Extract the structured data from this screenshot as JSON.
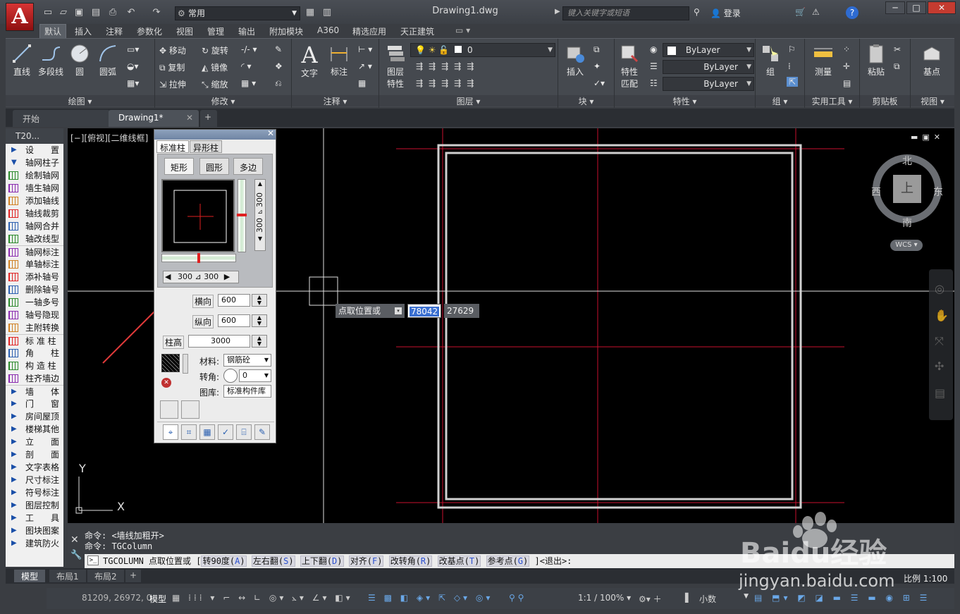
{
  "app": {
    "logo_letter": "A",
    "workspace": "常用",
    "document_title": "Drawing1.dwg",
    "search_placeholder": "键入关键字或短语",
    "login_label": "登录"
  },
  "menu": [
    "默认",
    "插入",
    "注释",
    "参数化",
    "视图",
    "管理",
    "输出",
    "附加模块",
    "A360",
    "精选应用",
    "天正建筑"
  ],
  "ribbon": {
    "draw": {
      "title": "绘图",
      "line": "直线",
      "polyline": "多段线",
      "circle": "圆",
      "arc": "圆弧"
    },
    "modify": {
      "title": "修改",
      "move": "移动",
      "rotate": "旋转",
      "copy": "复制",
      "mirror": "镜像",
      "stretch": "拉伸",
      "scale": "缩放"
    },
    "annotation": {
      "title": "注释",
      "text": "文字",
      "dimension": "标注"
    },
    "layers": {
      "title": "图层",
      "layer_props_1": "图层",
      "layer_props_2": "特性",
      "current_layer": "0"
    },
    "block": {
      "title": "块",
      "insert": "插入"
    },
    "properties": {
      "title": "特性",
      "match_1": "特性",
      "match_2": "匹配",
      "color": "ByLayer",
      "linetype": "ByLayer",
      "lineweight": "ByLayer"
    },
    "groups": {
      "title": "组",
      "group": "组"
    },
    "utilities": {
      "title": "实用工具",
      "measure": "测量"
    },
    "clipboard": {
      "title": "剪贴板",
      "paste": "粘贴"
    },
    "view": {
      "title": "视图",
      "base": "基点"
    }
  },
  "doc_tabs": {
    "start": "开始",
    "drawing": "Drawing1*"
  },
  "palette": {
    "title": "T20...",
    "items": [
      {
        "label": "设　　置",
        "type": "group"
      },
      {
        "label": "轴网柱子",
        "type": "group-open"
      },
      {
        "label": "绘制轴网",
        "type": "item"
      },
      {
        "label": "墙生轴网",
        "type": "item"
      },
      {
        "label": "添加轴线",
        "type": "item"
      },
      {
        "label": "轴线裁剪",
        "type": "item"
      },
      {
        "label": "轴网合并",
        "type": "item"
      },
      {
        "label": "轴改线型",
        "type": "item"
      },
      {
        "label": "轴网标注",
        "type": "item"
      },
      {
        "label": "单轴标注",
        "type": "item"
      },
      {
        "label": "添补轴号",
        "type": "item"
      },
      {
        "label": "删除轴号",
        "type": "item"
      },
      {
        "label": "一轴多号",
        "type": "item"
      },
      {
        "label": "轴号隐现",
        "type": "item"
      },
      {
        "label": "主附转换",
        "type": "item"
      },
      {
        "label": "标 准 柱",
        "type": "item"
      },
      {
        "label": "角　　柱",
        "type": "item"
      },
      {
        "label": "构 造 柱",
        "type": "item"
      },
      {
        "label": "柱齐墙边",
        "type": "item"
      },
      {
        "label": "墙　　体",
        "type": "group"
      },
      {
        "label": "门　　窗",
        "type": "group"
      },
      {
        "label": "房间屋顶",
        "type": "group"
      },
      {
        "label": "楼梯其他",
        "type": "group"
      },
      {
        "label": "立　　面",
        "type": "group"
      },
      {
        "label": "剖　　面",
        "type": "group"
      },
      {
        "label": "文字表格",
        "type": "group"
      },
      {
        "label": "尺寸标注",
        "type": "group"
      },
      {
        "label": "符号标注",
        "type": "group"
      },
      {
        "label": "图层控制",
        "type": "group"
      },
      {
        "label": "工　　具",
        "type": "group"
      },
      {
        "label": "图块图案",
        "type": "group"
      },
      {
        "label": "建筑防火",
        "type": "group"
      }
    ]
  },
  "viewport_label": "[−][俯视][二维线框]",
  "dialog": {
    "tab_standard": "标准柱",
    "tab_special": "异形柱",
    "shape_rect": "矩形",
    "shape_round": "圆形",
    "shape_poly": "多边",
    "vert_value_1": "300",
    "vert_value_2": "300",
    "horiz_value_1": "300",
    "horiz_value_2": "300",
    "spacing_x_label": "横向",
    "spacing_x": "600",
    "spacing_y_label": "纵向",
    "spacing_y": "600",
    "height_label": "柱高",
    "height": "3000",
    "material_label": "材料:",
    "material": "钢筋砼",
    "angle_label": "转角:",
    "angle": "0",
    "library_label": "图库:",
    "library": "标准构件库"
  },
  "dynamic_input": {
    "prompt": "点取位置或",
    "x": "78042",
    "y": "27629"
  },
  "viewcube": {
    "north": "北",
    "south": "南",
    "west": "西",
    "east": "东",
    "face": "上",
    "wcs": "WCS"
  },
  "command": {
    "history_1": "命令: <墙线加粗开>",
    "history_2": "命令: TGColumn",
    "prompt": "TGCOLUMN 点取位置或 [",
    "options": [
      {
        "label": "转90度(",
        "key": "A",
        "end": ")"
      },
      {
        "label": "左右翻(",
        "key": "S",
        "end": ")"
      },
      {
        "label": "上下翻(",
        "key": "D",
        "end": ")"
      },
      {
        "label": "对齐(",
        "key": "F",
        "end": ")"
      },
      {
        "label": "改转角(",
        "key": "R",
        "end": ")"
      },
      {
        "label": "改基点(",
        "key": "T",
        "end": ")"
      },
      {
        "label": "参考点(",
        "key": "G",
        "end": ")"
      }
    ],
    "suffix": "]<退出>:"
  },
  "layout_tabs": [
    "模型",
    "布局1",
    "布局2"
  ],
  "status": {
    "coords": "81209, 26972, 0",
    "model": "模型",
    "annotation_scale": "1:1 / 100%",
    "units": "小数",
    "scale_label": "比例 1:100"
  },
  "watermark": {
    "brand": "Baidu经验",
    "url": "jingyan.baidu.com"
  },
  "colors": {
    "accent_red": "#c8102e",
    "highlight": "#3a6fd0",
    "canvas": "#000000"
  }
}
